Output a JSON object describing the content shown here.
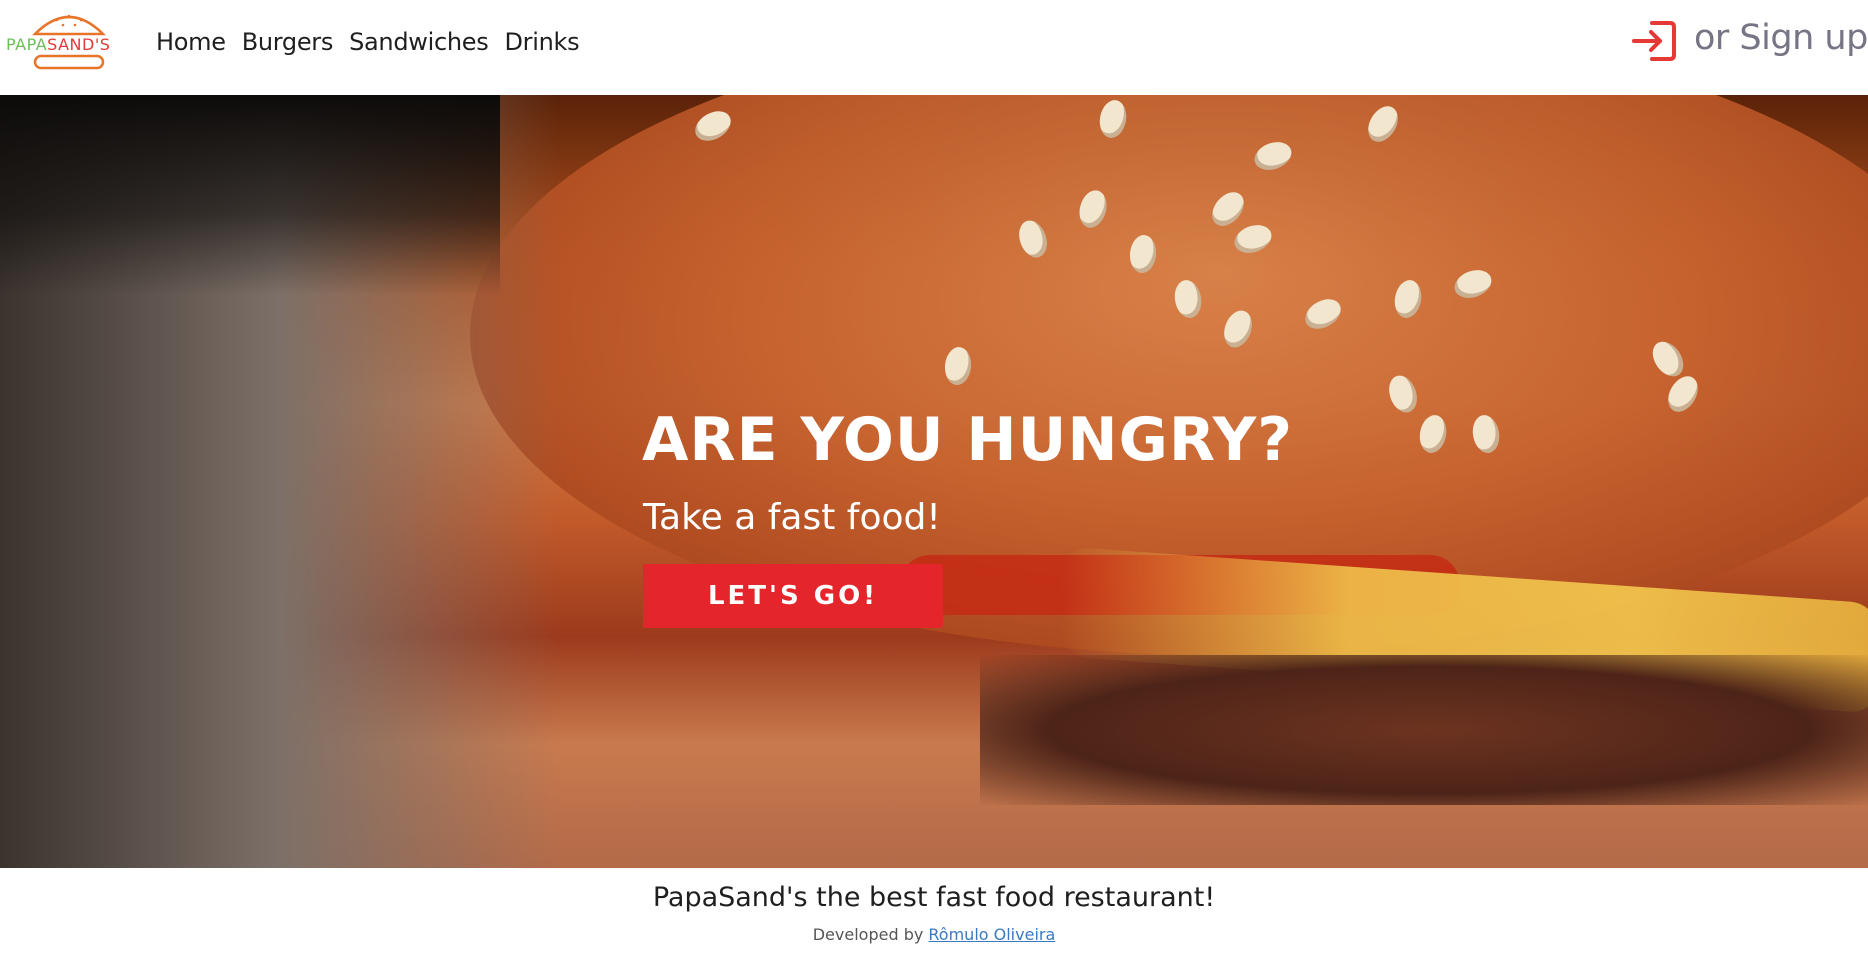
{
  "brand": {
    "part1": "PAPA",
    "part2": "SAND'S",
    "color_part1": "#6bbf59",
    "color_part2": "#e53935",
    "icon": "burger-logo-icon"
  },
  "nav": {
    "links": [
      "Home",
      "Burgers",
      "Sandwiches",
      "Drinks"
    ]
  },
  "auth": {
    "signin_icon": "sign-in-icon",
    "signup_label": "or Sign up",
    "icon_color": "#e53935"
  },
  "hero": {
    "title": "ARE YOU HUNGRY?",
    "subtitle": "Take a fast food!",
    "cta_label": "LET'S GO!",
    "cta_color": "#e4262c"
  },
  "footer": {
    "tagline": "PapaSand's the best fast food restaurant!",
    "credit_prefix": "Developed by ",
    "credit_name": "Rômulo Oliveira"
  }
}
